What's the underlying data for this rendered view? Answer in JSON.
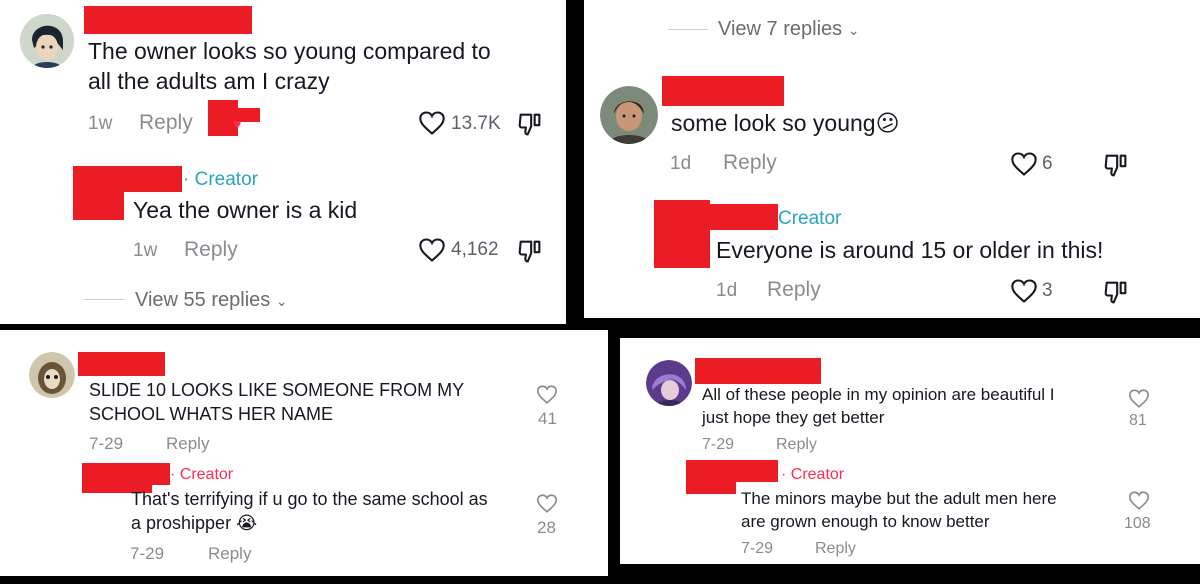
{
  "colors": {
    "redaction": "#ec1c24",
    "creator_teal": "#2aa4bd",
    "creator_red": "#fe2c55",
    "meta_gray": "#8a8b91"
  },
  "p1": {
    "comment": {
      "text_line1": "The owner looks so young compared to",
      "text_line2": "all the adults am I crazy",
      "time": "1w",
      "reply": "Reply",
      "likes": "13.7K"
    },
    "creator_reply": {
      "badge": "· Creator",
      "text": "Yea the owner is a kid",
      "time": "1w",
      "reply": "Reply",
      "likes": "4,162"
    },
    "view_replies": "View 55 replies"
  },
  "p2": {
    "view_replies": "View 7 replies",
    "comment": {
      "text": "some look so young",
      "emoji": "😕",
      "time": "1d",
      "reply": "Reply",
      "likes": "6"
    },
    "creator_reply": {
      "badge": "Creator",
      "text": "Everyone is around 15 or older in this!",
      "time": "1d",
      "reply": "Reply",
      "likes": "3"
    }
  },
  "p3": {
    "comment": {
      "text_line1": "SLIDE 10 LOOKS LIKE SOMEONE FROM MY",
      "text_line2": "SCHOOL WHATS HER NAME",
      "time": "7-29",
      "reply": "Reply",
      "likes": "41"
    },
    "creator_reply": {
      "badge": "· Creator",
      "text_line1": "That's terrifying if u go to the same school as",
      "text_line2": "a proshipper",
      "emoji": "😭",
      "time": "7-29",
      "reply": "Reply",
      "likes": "28"
    }
  },
  "p4": {
    "comment": {
      "text_line1": "All of these people in my opinion are beautiful I",
      "text_line2": "just hope they get better",
      "time": "7-29",
      "reply": "Reply",
      "likes": "81"
    },
    "creator_reply": {
      "badge": "· Creator",
      "text_line1": "The minors maybe but the adult men here",
      "text_line2": "are grown enough to know better",
      "time": "7-29",
      "reply": "Reply",
      "likes": "108"
    }
  }
}
